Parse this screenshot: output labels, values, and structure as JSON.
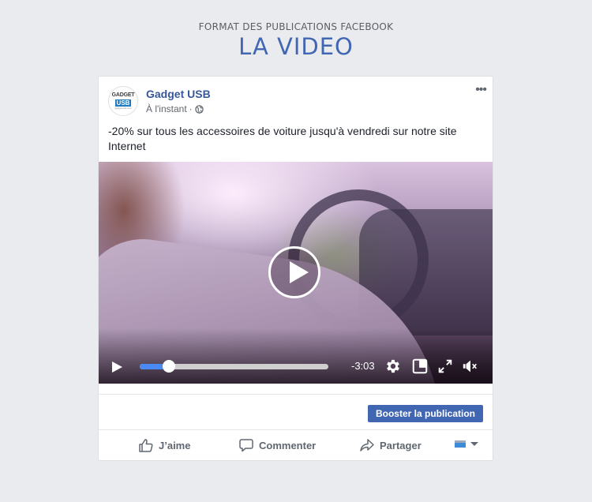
{
  "heading": {
    "subtitle": "FORMAT DES PUBLICATIONS FACEBOOK",
    "title": "LA VIDEO"
  },
  "post": {
    "page_name": "Gadget USB",
    "avatar": {
      "line1": "GADGET",
      "line2": "USB",
      "line3": "gadget-usb.com"
    },
    "timestamp": "À l'instant",
    "separator": "·",
    "privacy_icon": "globe-icon",
    "more_label": "•••",
    "text": "-20% sur tous les accessoires de voiture jusqu'à vendredi sur notre site Internet"
  },
  "video": {
    "progress_fraction": 0.155,
    "time_remaining": "-3:03",
    "icons": [
      "play-icon",
      "settings-icon",
      "picture-in-picture-icon",
      "fullscreen-icon",
      "mute-icon"
    ]
  },
  "boost_label": "Booster la publication",
  "actions": {
    "like": "J’aime",
    "comment": "Commenter",
    "share": "Partager"
  },
  "colors": {
    "brand": "#4267b2",
    "link": "#365899",
    "progress": "#4a8af4",
    "background": "#e9ebee"
  }
}
